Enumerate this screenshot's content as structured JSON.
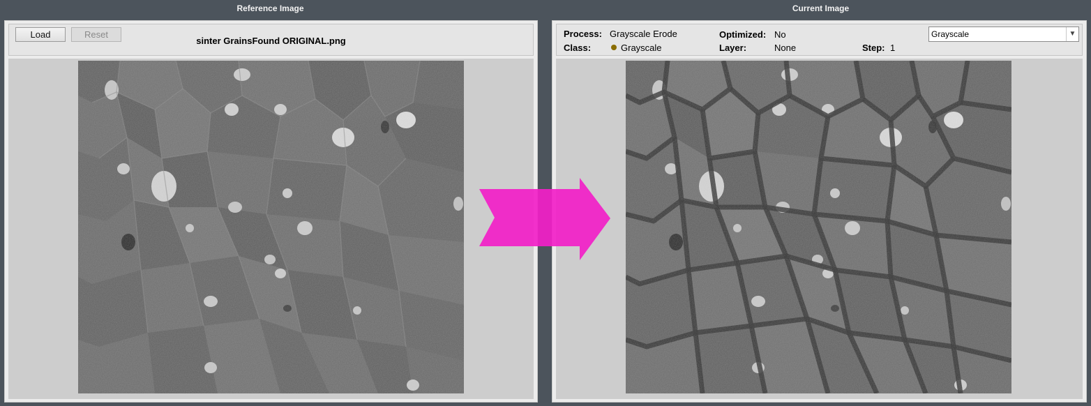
{
  "reference": {
    "title": "Reference Image",
    "load_label": "Load",
    "reset_label": "Reset",
    "filename": "sinter GrainsFound ORIGINAL.png"
  },
  "current": {
    "title": "Current Image",
    "process_label": "Process:",
    "process_value": "Grayscale Erode",
    "optimized_label": "Optimized:",
    "optimized_value": "No",
    "class_label": "Class:",
    "class_value": "Grayscale",
    "class_color": "#8a6d00",
    "layer_label": "Layer:",
    "layer_value": "None",
    "step_label": "Step:",
    "step_value": "1",
    "view_select": "Grayscale"
  },
  "arrow_color": "#f21fc8",
  "icons": {
    "dropdown": "chevron-down-icon",
    "arrow": "right-arrow-icon"
  }
}
